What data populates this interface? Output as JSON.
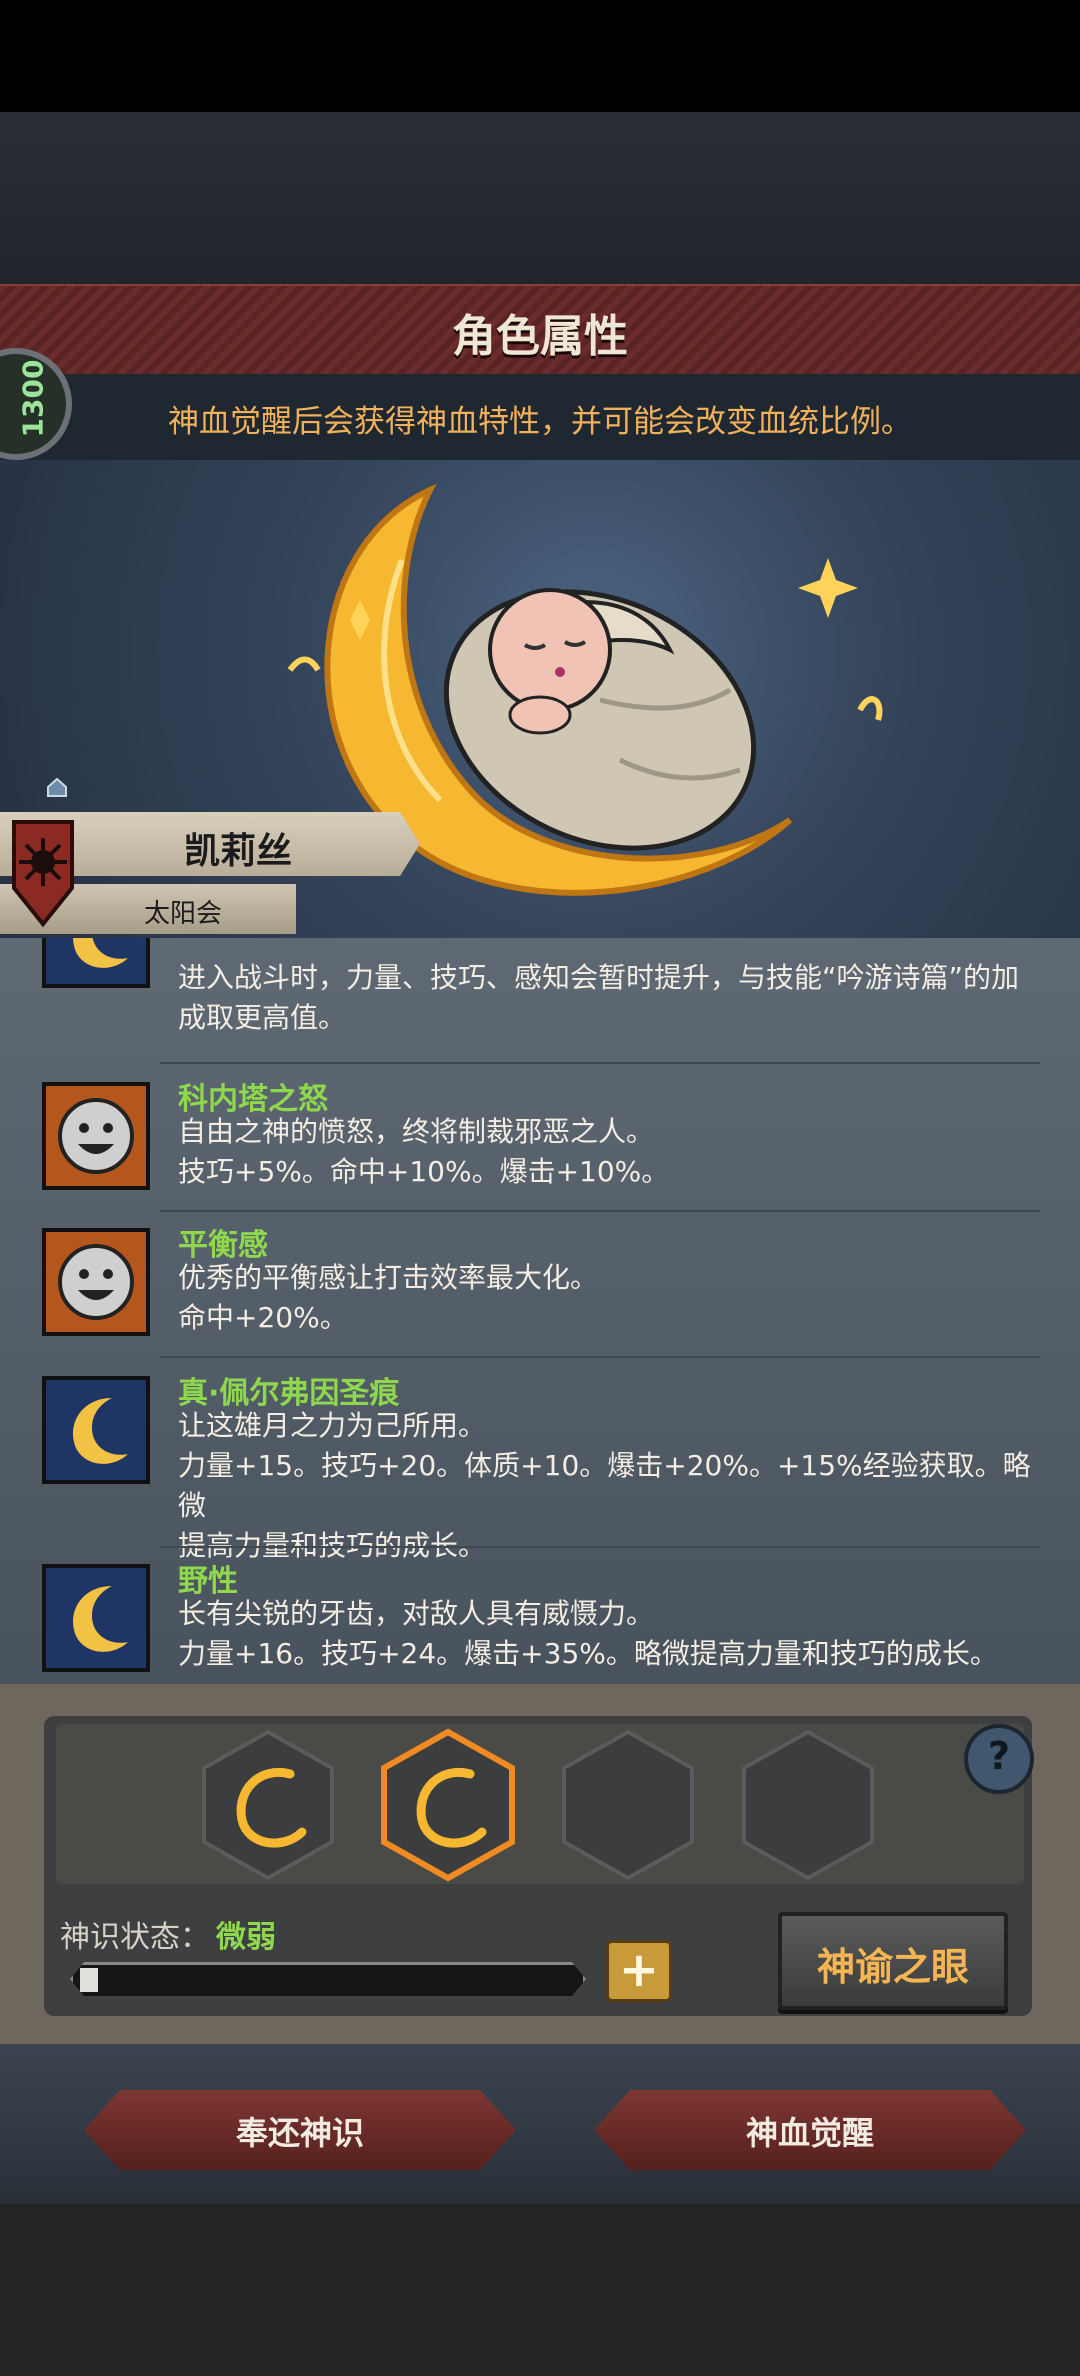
{
  "header": {
    "title": "角色属性",
    "subtitle": "神血觉醒后会获得神血特性，并可能会改变血统比例。",
    "badge_text": "1300"
  },
  "character": {
    "name": "凯莉丝",
    "guild": "太阳会"
  },
  "traits": [
    {
      "name": "",
      "desc_lines": [
        "进入战斗时，力量、技巧、感知会暂时提升，与技能“吟游诗篇”的加",
        "成取更高值。"
      ],
      "icon": "moon-icon"
    },
    {
      "name": "科内塔之怒",
      "desc_lines": [
        "自由之神的愤怒，终将制裁邪恶之人。",
        "技巧+5%。命中+10%。爆击+10%。"
      ],
      "icon": "smile-icon"
    },
    {
      "name": "平衡感",
      "desc_lines": [
        "优秀的平衡感让打击效率最大化。",
        "命中+20%。"
      ],
      "icon": "smile-icon"
    },
    {
      "name": "真·佩尔弗因圣痕",
      "desc_lines": [
        "让这雄月之力为己所用。",
        "力量+15。技巧+20。体质+10。爆击+20%。+15%经验获取。略微",
        "提高力量和技巧的成长。"
      ],
      "icon": "moon-icon"
    },
    {
      "name": "野性",
      "desc_lines": [
        "长有尖锐的牙齿，对敌人具有威慑力。",
        "力量+16。技巧+24。爆击+35%。略微提高力量和技巧的成长。"
      ],
      "icon": "moon-icon"
    }
  ],
  "divine_sense": {
    "label": "神识状态：",
    "value": "微弱",
    "progress": 0.03,
    "plus_label": "+",
    "eye_button": "神谕之眼",
    "help": "?"
  },
  "footer": {
    "return_button": "奉还神识",
    "awaken_button": "神血觉醒"
  },
  "colors": {
    "accent_green": "#8fd84e",
    "accent_gold": "#f4b552",
    "title_red": "#6b2c2c"
  }
}
